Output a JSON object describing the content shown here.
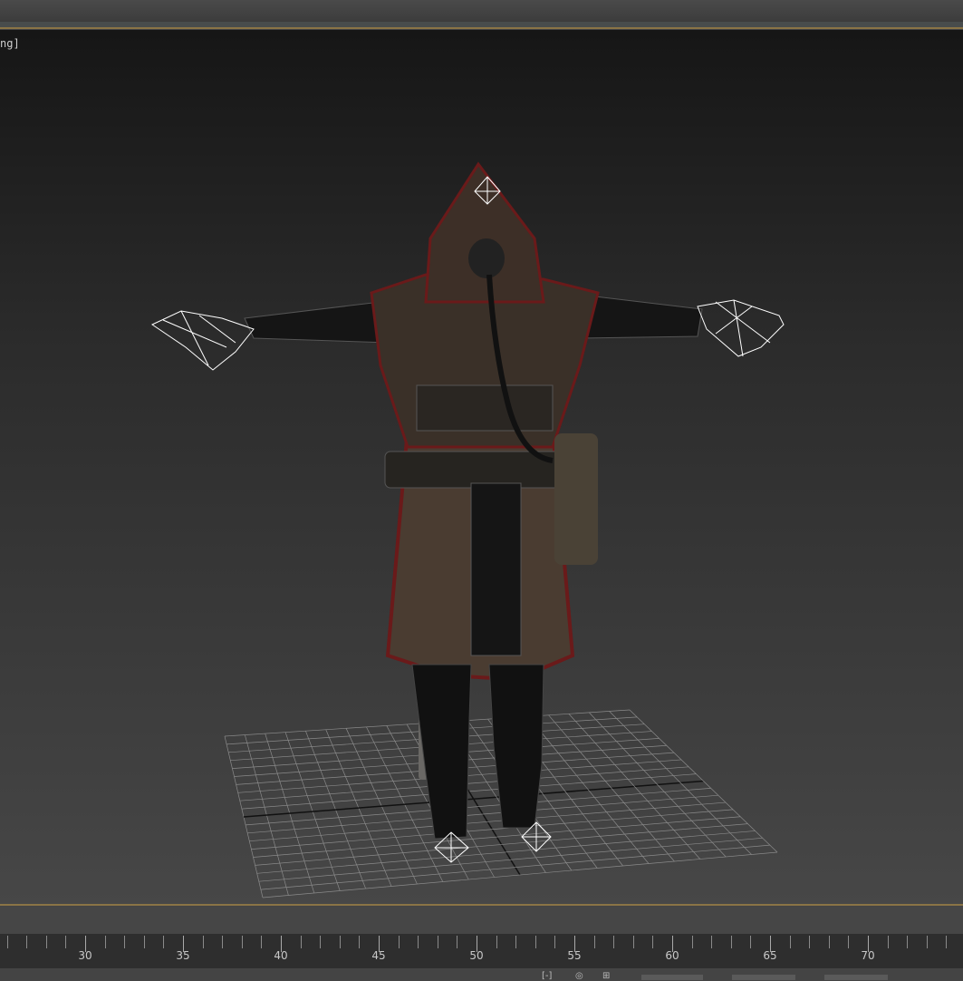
{
  "viewport": {
    "label": "ng]",
    "background_top": "#161616",
    "background_bottom": "#474747",
    "accent_border": "#8a7446"
  },
  "timeline": {
    "labels": [
      "30",
      "35",
      "40",
      "45",
      "50",
      "55",
      "60",
      "65",
      "70"
    ],
    "first_label_frame": 30,
    "frame_step": 5
  },
  "bottom_bar": {
    "icons": [
      "zoom-extents-icon",
      "orbit-icon",
      "maximize-viewport-icon"
    ]
  }
}
